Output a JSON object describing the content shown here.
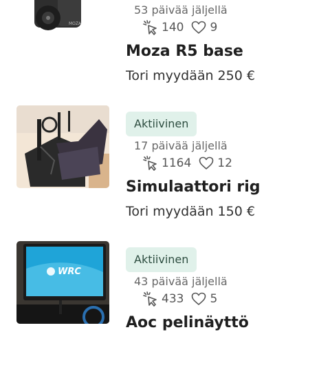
{
  "listings": [
    {
      "status": "",
      "days_left": "53 päivää jäljellä",
      "views": "140",
      "likes": "9",
      "title": "Moza R5 base",
      "price": "Tori myydään 250 €",
      "image_logo": "MOZA"
    },
    {
      "status": "Aktiivinen",
      "days_left": "17 päivää jäljellä",
      "views": "1164",
      "likes": "12",
      "title": "Simulaattori rig",
      "price": "Tori myydään 150 €"
    },
    {
      "status": "Aktiivinen",
      "days_left": "43 päivää jäljellä",
      "views": "433",
      "likes": "5",
      "title": "Aoc pelinäyttö",
      "price": "",
      "image_logo": "WRC"
    }
  ],
  "icons": {
    "views": "cursor-click-icon",
    "likes": "heart-icon"
  },
  "colors": {
    "badge_bg": "#e0f1ea",
    "badge_text": "#2d4d40"
  }
}
